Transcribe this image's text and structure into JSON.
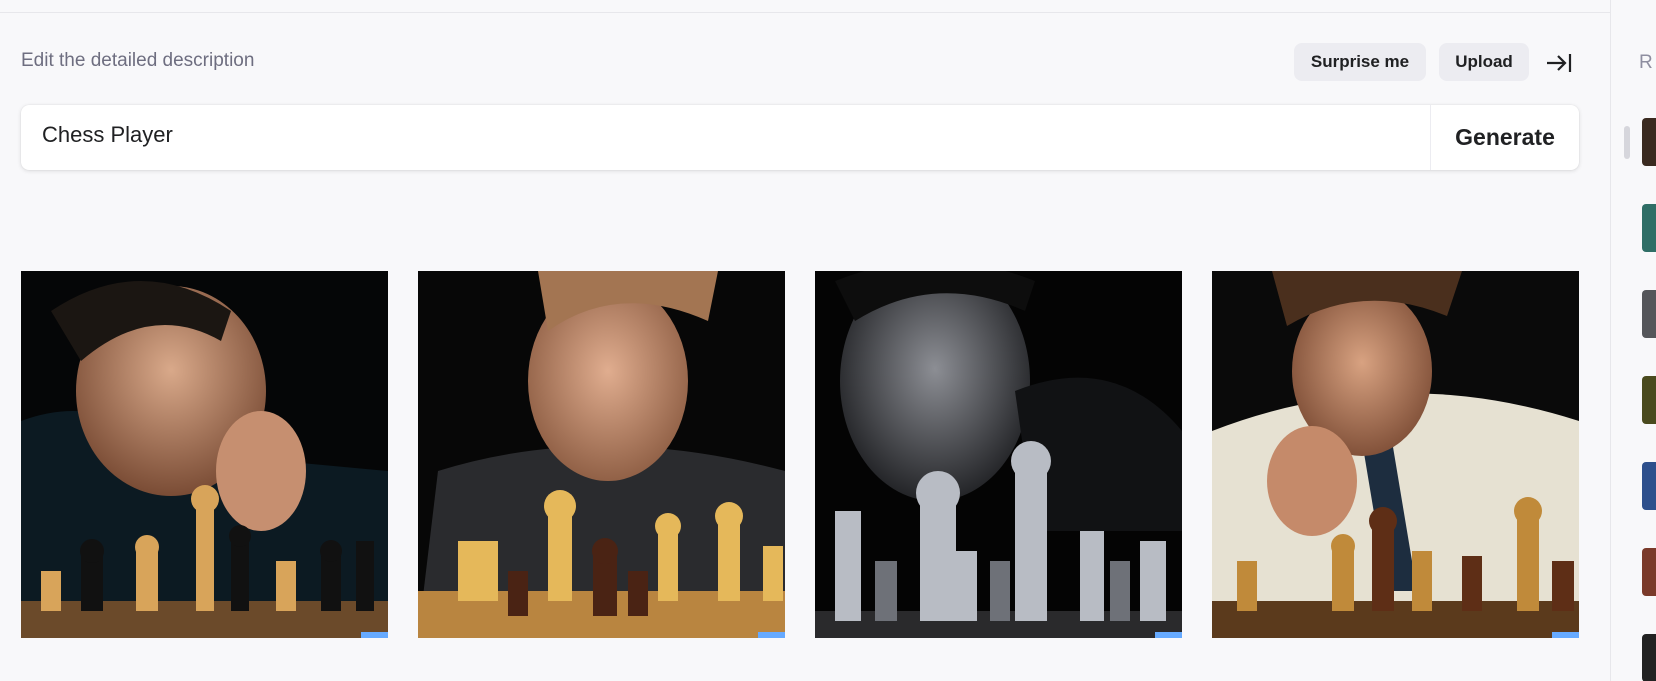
{
  "header": {
    "edit_label": "Edit the detailed description",
    "surprise_label": "Surprise me",
    "upload_label": "Upload"
  },
  "prompt": {
    "value": "Chess Player",
    "generate_label": "Generate"
  },
  "results": [
    {
      "alt": "Chess player image 1"
    },
    {
      "alt": "Chess player image 2"
    },
    {
      "alt": "Chess player image 3"
    },
    {
      "alt": "Chess player image 4"
    }
  ],
  "sidebar": {
    "title": "R"
  },
  "colors": {
    "background": "#f8f8fa",
    "pill": "#ececf1",
    "text": "#202123",
    "muted": "#6e6e80"
  }
}
